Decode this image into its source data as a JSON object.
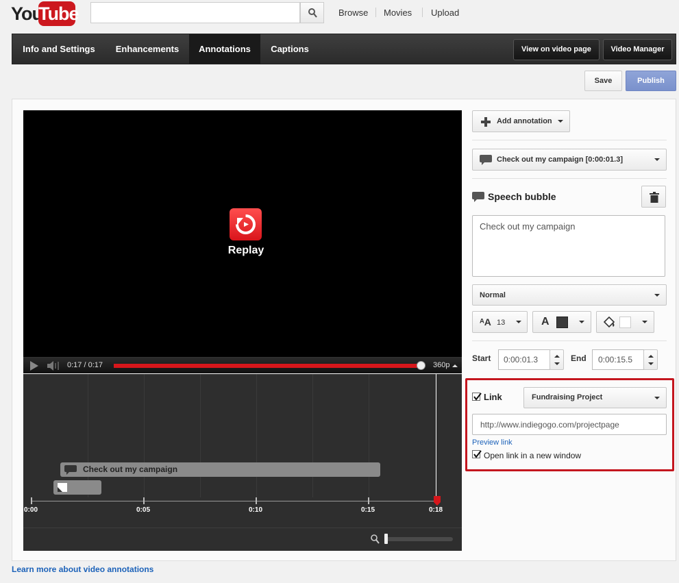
{
  "header": {
    "logo_you": "You",
    "logo_tube": "Tube",
    "search_placeholder": "",
    "nav": [
      "Browse",
      "Movies",
      "Upload"
    ]
  },
  "tabs": [
    {
      "label": "Info and Settings",
      "active": false
    },
    {
      "label": "Enhancements",
      "active": false
    },
    {
      "label": "Annotations",
      "active": true
    },
    {
      "label": "Captions",
      "active": false
    }
  ],
  "tab_actions": {
    "view_on_video_page": "View on video page",
    "video_manager": "Video Manager"
  },
  "actions": {
    "save": "Save",
    "publish": "Publish"
  },
  "player": {
    "replay_label": "Replay",
    "time_display": "0:17 / 0:17",
    "quality": "360p",
    "progress": 1.0
  },
  "timeline": {
    "annotation_label": "Check out my campaign",
    "ticks": [
      "0:00",
      "0:05",
      "0:10",
      "0:15",
      "0:18"
    ]
  },
  "editor": {
    "add_annotation": "Add annotation",
    "selected_annotation": "Check out my campaign [0:00:01.3]",
    "type_title": "Speech bubble",
    "text": "Check out my campaign",
    "style": "Normal",
    "font_size": "13",
    "start_label": "Start",
    "start_value": "0:00:01.3",
    "end_label": "End",
    "end_value": "0:00:15.5"
  },
  "link": {
    "checked": true,
    "label": "Link",
    "type": "Fundraising Project",
    "url": "http://www.indiegogo.com/projectpage",
    "preview": "Preview link",
    "new_window_checked": true,
    "new_window_label": "Open link in a new window"
  },
  "footer": {
    "learn_more": "Learn more about video annotations"
  },
  "colors": {
    "accent_red": "#cc181e",
    "highlight_box": "#c4161e",
    "publish_blue": "#7a91cc",
    "link_blue": "#1c62b9"
  }
}
